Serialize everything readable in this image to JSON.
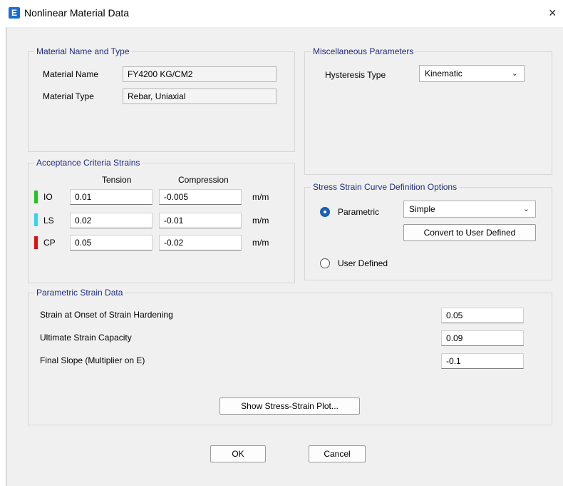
{
  "window": {
    "title": "Nonlinear Material Data",
    "app_icon_letter": "E",
    "close_glyph": "×"
  },
  "material": {
    "group_title": "Material Name and Type",
    "name_label": "Material Name",
    "name_value": "FY4200 KG/CM2",
    "type_label": "Material Type",
    "type_value": "Rebar, Uniaxial"
  },
  "misc": {
    "group_title": "Miscellaneous Parameters",
    "hysteresis_label": "Hysteresis Type",
    "hysteresis_value": "Kinematic"
  },
  "acceptance": {
    "group_title": "Acceptance Criteria Strains",
    "col_tension": "Tension",
    "col_compression": "Compression",
    "rows": [
      {
        "label": "IO",
        "color": "#22c322",
        "tension": "0.01",
        "compression": "-0.005",
        "unit": "m/m"
      },
      {
        "label": "LS",
        "color": "#33d6ee",
        "tension": "0.02",
        "compression": "-0.01",
        "unit": "m/m"
      },
      {
        "label": "CP",
        "color": "#e01010",
        "tension": "0.05",
        "compression": "-0.02",
        "unit": "m/m"
      }
    ]
  },
  "curve": {
    "group_title": "Stress Strain Curve Definition Options",
    "parametric_label": "Parametric",
    "parametric_checked": true,
    "parametric_option": "Simple",
    "convert_button": "Convert to User Defined",
    "user_defined_label": "User Defined",
    "user_defined_checked": false
  },
  "strain": {
    "group_title": "Parametric Strain Data",
    "rows": [
      {
        "label": "Strain at Onset of Strain Hardening",
        "value": "0.05"
      },
      {
        "label": "Ultimate Strain Capacity",
        "value": "0.09"
      },
      {
        "label": "Final Slope (Multiplier on E)",
        "value": "-0.1"
      }
    ],
    "plot_button": "Show Stress-Strain Plot..."
  },
  "footer": {
    "ok": "OK",
    "cancel": "Cancel"
  },
  "icons": {
    "chevron": "chevron-down-icon",
    "close": "close-icon"
  },
  "colors": {
    "group_title": "#1f2d80",
    "dialog_bg": "#f0f0f0",
    "radio_checked": "#1a5fb4"
  }
}
